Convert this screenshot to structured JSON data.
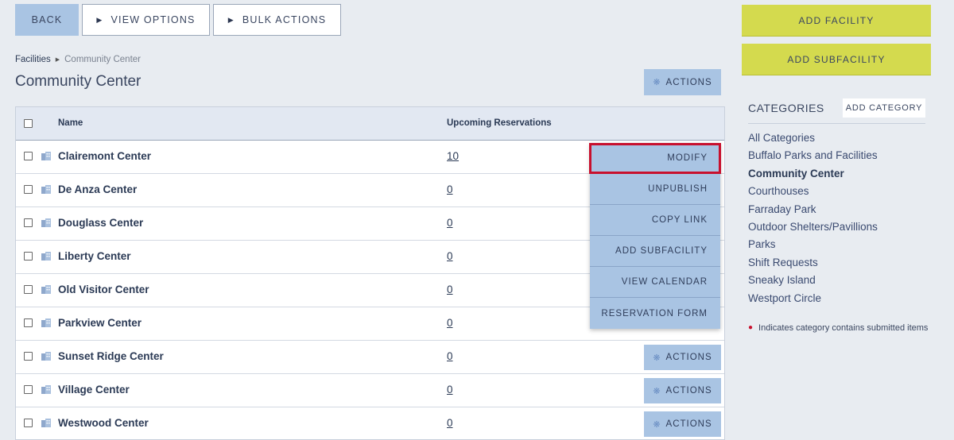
{
  "toolbar": {
    "back": "Back",
    "view_options": "View Options",
    "bulk_actions": "Bulk Actions"
  },
  "breadcrumb": {
    "parent": "Facilities",
    "current": "Community Center"
  },
  "page_title": "Community Center",
  "actions_label": "Actions",
  "table": {
    "headers": {
      "name": "Name",
      "upcoming": "Upcoming Reservations"
    },
    "rows": [
      {
        "name": "Clairemont Center",
        "count": "10"
      },
      {
        "name": "De Anza Center",
        "count": "0"
      },
      {
        "name": "Douglass Center",
        "count": "0"
      },
      {
        "name": "Liberty Center",
        "count": "0"
      },
      {
        "name": "Old Visitor Center",
        "count": "0"
      },
      {
        "name": "Parkview Center",
        "count": "0"
      },
      {
        "name": "Sunset Ridge Center",
        "count": "0"
      },
      {
        "name": "Village Center",
        "count": "0"
      },
      {
        "name": "Westwood Center",
        "count": "0"
      }
    ]
  },
  "dropdown": [
    "Modify",
    "Unpublish",
    "Copy Link",
    "Add Subfacility",
    "View Calendar",
    "Reservation Form"
  ],
  "sidebar": {
    "add_facility": "Add Facility",
    "add_subfacility": "Add Subfacility",
    "categories_title": "Categories",
    "add_category": "Add Category",
    "categories": [
      "All Categories",
      "Buffalo Parks and Facilities",
      "Community Center",
      "Courthouses",
      "Farraday Park",
      "Outdoor Shelters/Pavillions",
      "Parks",
      "Shift Requests",
      "Sneaky Island",
      "Westport Circle"
    ],
    "active_category": "Community Center",
    "note": "Indicates category contains submitted items"
  },
  "colors": {
    "accent_blue": "#a9c4e3",
    "accent_yellow": "#d4da4e",
    "highlight": "#c8102e"
  }
}
